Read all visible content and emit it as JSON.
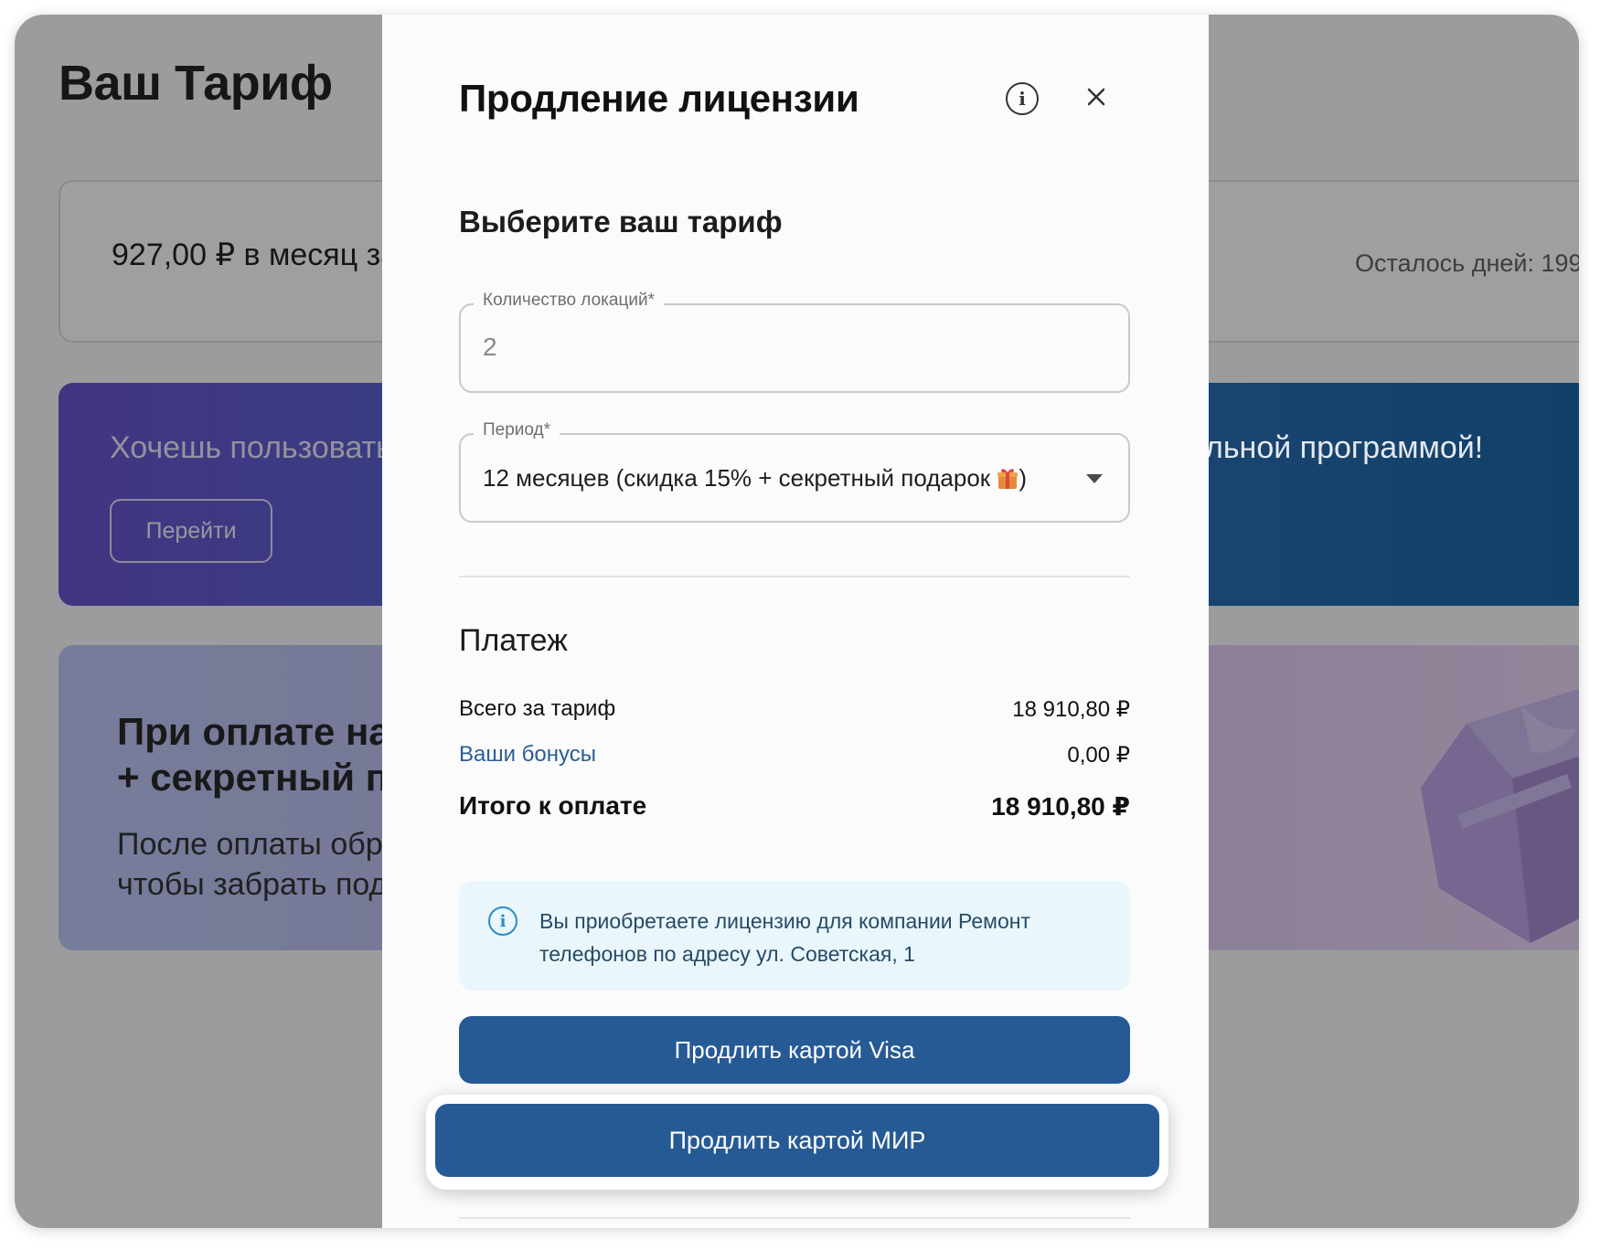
{
  "background": {
    "title": "Ваш Тариф",
    "price_text": "927,00 ₽ в месяц за",
    "days_left": "Осталось дней: 199",
    "promo": {
      "text_left": "Хочешь пользовать",
      "text_right": "льной программой!",
      "go_button": "Перейти"
    },
    "gift_banner": {
      "heading_line1": "При оплате на",
      "heading_line2": "+ секретный п",
      "sub_line1": "После оплаты обра",
      "sub_line2": "чтобы забрать пода"
    }
  },
  "modal": {
    "title": "Продление лицензии",
    "section_title": "Выберите ваш тариф",
    "locations": {
      "label": "Количество локаций*",
      "value": "2"
    },
    "period": {
      "label": "Период*",
      "value": "12 месяцев (скидка 15% + секретный подарок ",
      "value_end": ")"
    },
    "payment": {
      "title": "Платеж",
      "total_label": "Всего за тариф",
      "total_value": "18 910,80 ₽",
      "bonus_label": "Ваши бонусы",
      "bonus_value": "0,00 ₽",
      "final_label": "Итого к оплате",
      "final_value": "18 910,80 ₽"
    },
    "notice": "Вы приобретаете лицензию для компании Ремонт телефонов по адресу ул. Советская, 1",
    "buttons": {
      "visa": "Продлить картой Visa",
      "mir": "Продлить картой МИР"
    }
  },
  "colors": {
    "primary_button": "#265a95",
    "bonus_link": "#2a5d97",
    "notice_bg": "#e9f6fb",
    "info_icon": "#2a8cc4"
  },
  "icons": [
    "info-icon",
    "close-icon",
    "chevron-down-icon",
    "gift-icon"
  ]
}
